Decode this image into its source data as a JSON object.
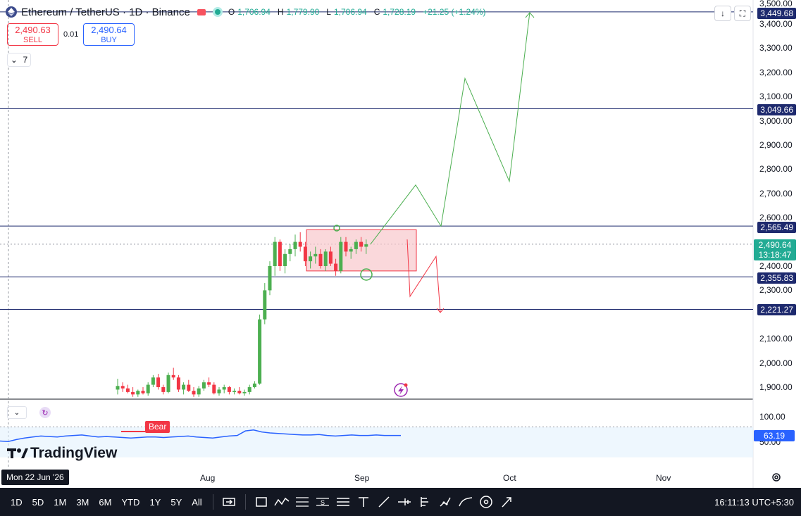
{
  "header": {
    "symbol": "Ethereum / TetherUS · 1D · Binance",
    "open_label": "O",
    "open": "1,706.94",
    "high_label": "H",
    "high": "1,779.90",
    "low_label": "L",
    "low": "1,706.94",
    "close_label": "C",
    "close": "1,728.19",
    "change": "+21.25 (+1.24%)"
  },
  "trade": {
    "sell_price": "2,490.63",
    "sell_label": "SELL",
    "spread": "0.01",
    "buy_price": "2,490.64",
    "buy_label": "BUY"
  },
  "indicator_toggle": "7",
  "price_axis": {
    "ticks": [
      "3,400.00",
      "3,300.00",
      "3,200.00",
      "3,100.00",
      "3,000.00",
      "2,900.00",
      "2,800.00",
      "2,700.00",
      "2,600.00",
      "2,400.00",
      "2,300.00",
      "2,100.00",
      "2,000.00",
      "1,900.00"
    ],
    "top_partial": "3,500.00",
    "levels": [
      "3,449.68",
      "3,049.66",
      "2,565.49",
      "2,355.83",
      "2,221.27"
    ],
    "current_price": "2,490.64",
    "countdown": "13:18:47"
  },
  "oscillator": {
    "ticks": [
      "100.00",
      "50.00"
    ],
    "value": "63.19",
    "signal_tag": "Bear"
  },
  "time_axis": {
    "labels": [
      "Aug",
      "Sep",
      "Oct",
      "Nov"
    ],
    "crosshair_date": "Mon 22 Jun '26"
  },
  "brand": "TradingView",
  "toolbar": {
    "timeframes": [
      "1D",
      "5D",
      "1M",
      "3M",
      "6M",
      "YTD",
      "1Y",
      "5Y",
      "All"
    ],
    "tools": [
      "replay-icon",
      "rectangle-icon",
      "path-icon",
      "fib-icon",
      "pattern-icon",
      "lines-icon",
      "text-icon",
      "trendline-icon",
      "ruler-icon",
      "long-position-icon",
      "brush-icon",
      "curve-icon",
      "eye-icon",
      "arrow-icon"
    ],
    "clock": "16:11:13 UTC+5:30"
  },
  "colors": {
    "up": "#22ab94",
    "candle_up": "#4caf50",
    "down": "#f23645",
    "level_line": "#1e2a6e",
    "projection_up": "#4caf50",
    "projection_down": "#f23645",
    "range_box": "#f8c8cc",
    "oscillator": "#2962ff"
  },
  "chart_data": {
    "type": "candlestick",
    "symbol": "ETHUSDT",
    "interval": "1D",
    "y_range": [
      1860,
      3520
    ],
    "recent_range": {
      "low": 2380,
      "high": 2550
    },
    "candles": [
      [
        1890,
        1935,
        1870,
        1905
      ],
      [
        1905,
        1920,
        1880,
        1895
      ],
      [
        1895,
        1910,
        1875,
        1880
      ],
      [
        1880,
        1900,
        1860,
        1870
      ],
      [
        1870,
        1890,
        1860,
        1885
      ],
      [
        1885,
        1900,
        1870,
        1875
      ],
      [
        1875,
        1920,
        1865,
        1910
      ],
      [
        1910,
        1950,
        1900,
        1940
      ],
      [
        1940,
        1955,
        1890,
        1900
      ],
      [
        1900,
        1910,
        1870,
        1880
      ],
      [
        1880,
        1960,
        1875,
        1950
      ],
      [
        1950,
        1980,
        1930,
        1940
      ],
      [
        1940,
        1950,
        1880,
        1890
      ],
      [
        1890,
        1920,
        1870,
        1910
      ],
      [
        1910,
        1930,
        1880,
        1885
      ],
      [
        1885,
        1900,
        1860,
        1870
      ],
      [
        1870,
        1905,
        1860,
        1895
      ],
      [
        1895,
        1930,
        1885,
        1920
      ],
      [
        1920,
        1940,
        1900,
        1910
      ],
      [
        1910,
        1920,
        1870,
        1875
      ],
      [
        1875,
        1900,
        1865,
        1890
      ],
      [
        1890,
        1910,
        1875,
        1900
      ],
      [
        1900,
        1905,
        1870,
        1880
      ],
      [
        1880,
        1895,
        1870,
        1885
      ],
      [
        1885,
        1900,
        1870,
        1875
      ],
      [
        1875,
        1890,
        1865,
        1880
      ],
      [
        1880,
        1910,
        1870,
        1900
      ],
      [
        1900,
        1925,
        1895,
        1915
      ],
      [
        1915,
        2200,
        1910,
        2180
      ],
      [
        2180,
        2330,
        2160,
        2300
      ],
      [
        2300,
        2420,
        2280,
        2400
      ],
      [
        2400,
        2520,
        2360,
        2500
      ],
      [
        2500,
        2510,
        2380,
        2400
      ],
      [
        2400,
        2470,
        2370,
        2450
      ],
      [
        2450,
        2490,
        2420,
        2470
      ],
      [
        2470,
        2530,
        2440,
        2500
      ],
      [
        2500,
        2540,
        2460,
        2480
      ],
      [
        2480,
        2500,
        2400,
        2420
      ],
      [
        2420,
        2460,
        2390,
        2440
      ],
      [
        2440,
        2480,
        2410,
        2450
      ],
      [
        2450,
        2470,
        2390,
        2400
      ],
      [
        2400,
        2470,
        2380,
        2460
      ],
      [
        2460,
        2480,
        2400,
        2410
      ],
      [
        2410,
        2430,
        2360,
        2380
      ],
      [
        2380,
        2520,
        2370,
        2500
      ],
      [
        2500,
        2520,
        2440,
        2460
      ],
      [
        2460,
        2480,
        2430,
        2470
      ],
      [
        2470,
        2510,
        2450,
        2500
      ],
      [
        2500,
        2520,
        2460,
        2480
      ],
      [
        2480,
        2510,
        2450,
        2490
      ]
    ],
    "projection_bull": [
      [
        2492,
        2735
      ],
      [
        2560,
        3175
      ],
      [
        2750,
        3449
      ]
    ],
    "projection_bear": [
      [
        2492,
        2275
      ],
      [
        2440,
        2210
      ]
    ],
    "levels": [
      3449.68,
      3049.66,
      2565.49,
      2355.83,
      2221.27
    ],
    "oscillator_values": [
      52,
      51,
      55,
      58,
      60,
      62,
      61,
      60,
      62,
      63,
      64,
      62,
      60,
      61,
      60,
      59,
      58,
      59,
      60,
      60,
      59,
      60,
      61,
      62,
      60,
      59,
      58,
      60,
      62,
      63,
      72,
      74,
      70,
      68,
      67,
      66,
      65,
      64,
      64,
      65,
      63,
      62,
      63,
      64,
      63,
      63,
      64,
      63,
      63,
      63
    ]
  }
}
